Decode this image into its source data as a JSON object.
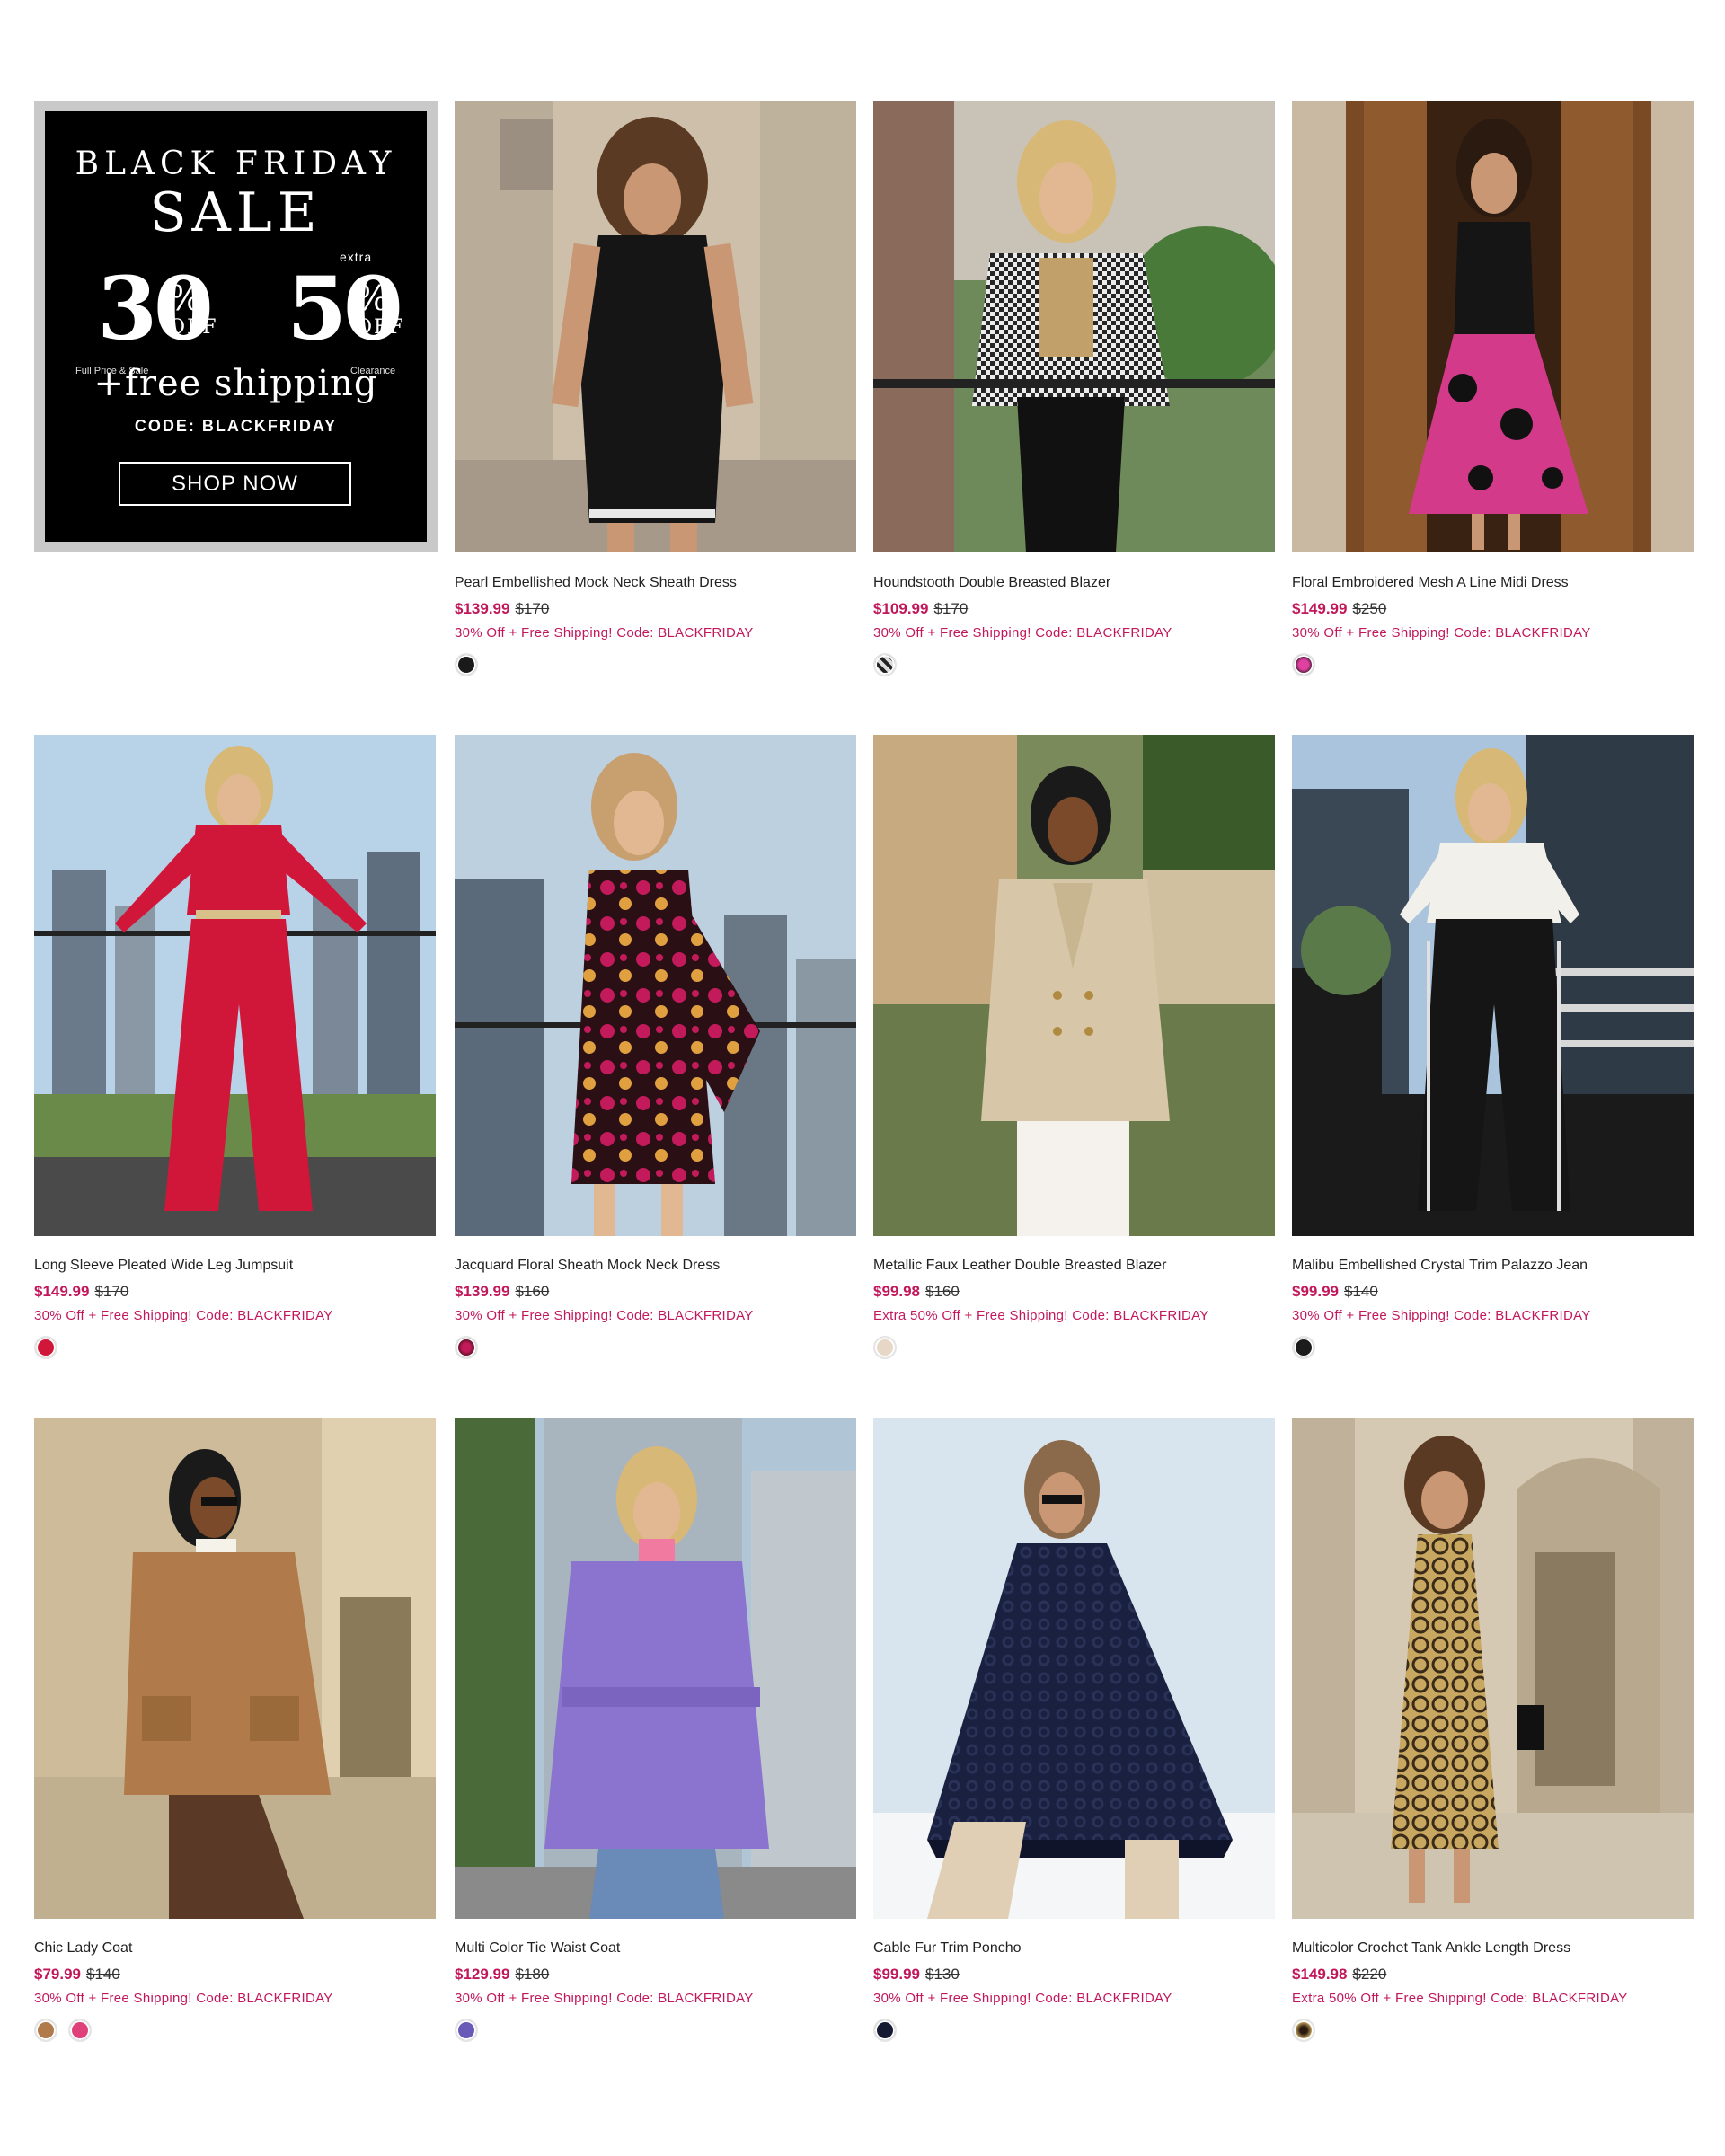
{
  "promo": {
    "title_line1": "BLACK FRIDAY",
    "title_line2": "SALE",
    "left_pct": "30",
    "left_off": "OFF",
    "left_fine": "Full Price & Sale",
    "right_extra": "extra",
    "right_pct": "50",
    "right_off": "OFF",
    "right_fine": "Clearance",
    "pct_symbol": "%",
    "shipping": "+free shipping",
    "code": "CODE: BLACKFRIDAY",
    "button": "SHOP NOW"
  },
  "colors": {
    "accent": "#c2185b",
    "promo_bg": "#000000"
  },
  "products": [
    {
      "name": "Pearl Embellished Mock Neck Sheath Dress",
      "sale": "$139.99",
      "orig": "$170",
      "promo": "30% Off + Free Shipping! Code: BLACKFRIDAY",
      "swatches": [
        "#1a1a1a"
      ]
    },
    {
      "name": "Houndstooth Double Breasted Blazer",
      "sale": "$109.99",
      "orig": "$170",
      "promo": "30% Off + Free Shipping! Code: BLACKFRIDAY",
      "swatches": [
        "#5a5a5a"
      ]
    },
    {
      "name": "Floral Embroidered Mesh A Line Midi Dress",
      "sale": "$149.99",
      "orig": "$250",
      "promo": "30% Off + Free Shipping! Code: BLACKFRIDAY",
      "swatches": [
        "#b0206c"
      ]
    },
    {
      "name": "Long Sleeve Pleated Wide Leg Jumpsuit",
      "sale": "$149.99",
      "orig": "$170",
      "promo": "30% Off + Free Shipping! Code: BLACKFRIDAY",
      "swatches": [
        "#d0173a"
      ]
    },
    {
      "name": "Jacquard Floral Sheath Mock Neck Dress",
      "sale": "$139.99",
      "orig": "$160",
      "promo": "30% Off + Free Shipping! Code: BLACKFRIDAY",
      "swatches": [
        "#8b1a1a"
      ]
    },
    {
      "name": "Metallic Faux Leather Double Breasted Blazer",
      "sale": "$99.98",
      "orig": "$160",
      "promo": "Extra 50% Off + Free Shipping! Code: BLACKFRIDAY",
      "swatches": [
        "#e6d7c6"
      ]
    },
    {
      "name": "Malibu Embellished Crystal Trim Palazzo Jean",
      "sale": "$99.99",
      "orig": "$140",
      "promo": "30% Off + Free Shipping! Code: BLACKFRIDAY",
      "swatches": [
        "#1c1c1c"
      ]
    },
    {
      "name": "Chic Lady Coat",
      "sale": "$79.99",
      "orig": "$140",
      "promo": "30% Off + Free Shipping! Code: BLACKFRIDAY",
      "swatches": [
        "#b07a4a",
        "#e0407a"
      ]
    },
    {
      "name": "Multi Color Tie Waist Coat",
      "sale": "$129.99",
      "orig": "$180",
      "promo": "30% Off + Free Shipping! Code: BLACKFRIDAY",
      "swatches": [
        "#6a5ab8"
      ]
    },
    {
      "name": "Cable Fur Trim Poncho",
      "sale": "$99.99",
      "orig": "$130",
      "promo": "30% Off + Free Shipping! Code: BLACKFRIDAY",
      "swatches": [
        "#151a33"
      ]
    },
    {
      "name": "Multicolor Crochet Tank Ankle Length Dress",
      "sale": "$149.98",
      "orig": "$220",
      "promo": "Extra 50% Off + Free Shipping! Code: BLACKFRIDAY",
      "swatches": [
        "#8a6a3a"
      ]
    }
  ]
}
